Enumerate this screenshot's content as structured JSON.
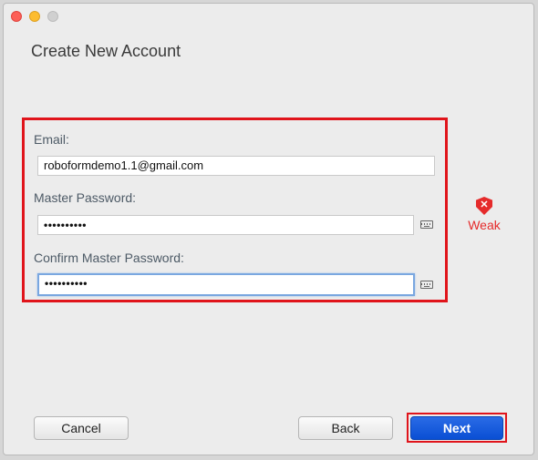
{
  "window": {
    "controls": [
      "close",
      "minimize",
      "maximize"
    ]
  },
  "title": "Create New Account",
  "form": {
    "email_label": "Email:",
    "email_value": "roboformdemo1.1@gmail.com",
    "master_password_label": "Master Password:",
    "master_password_value": "••••••••••",
    "confirm_password_label": "Confirm Master Password:",
    "confirm_password_value": "••••••••••",
    "keyboard_icon": "keyboard-icon"
  },
  "strength": {
    "icon": "shield-x-icon",
    "icon_glyph": "✕",
    "label": "Weak",
    "color": "#e52b2b"
  },
  "buttons": {
    "cancel": "Cancel",
    "back": "Back",
    "next": "Next"
  },
  "colors": {
    "highlight": "#e0141b",
    "primary": "#0a4fd4"
  }
}
